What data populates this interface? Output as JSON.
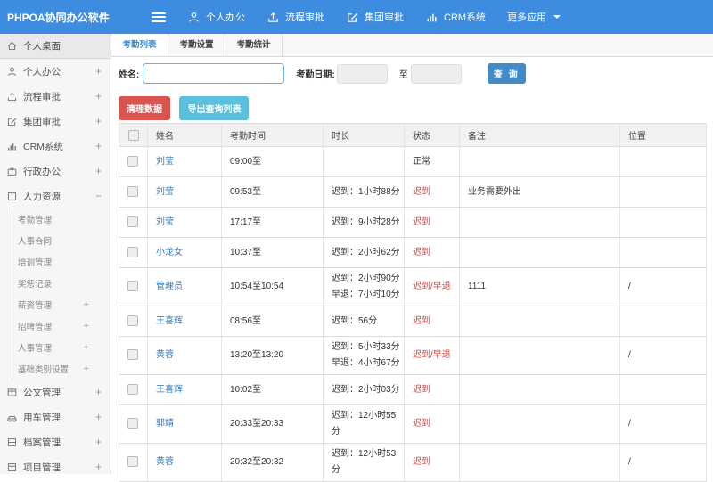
{
  "colors": {
    "header": "#3d8ce0",
    "primary": "#428bca",
    "danger": "#d9534f",
    "info": "#5bc0de",
    "link": "#3178b9",
    "alert_text": "#d9433c"
  },
  "brand": {
    "logo": "PHPOA协同办公软件"
  },
  "topnav": {
    "items": [
      {
        "icon": "user-icon",
        "label": "个人办公"
      },
      {
        "icon": "flow-icon",
        "label": "流程审批"
      },
      {
        "icon": "edit-icon",
        "label": "集团审批"
      },
      {
        "icon": "chart-icon",
        "label": "CRM系统"
      },
      {
        "icon": "",
        "label": "更多应用",
        "caret": true
      }
    ]
  },
  "sidebar": {
    "items": [
      {
        "label": "个人桌面",
        "icon": "home-icon",
        "level": "main",
        "active": true,
        "expand": ""
      },
      {
        "label": "个人办公",
        "icon": "user-icon",
        "level": "main",
        "expand": "+"
      },
      {
        "label": "流程审批",
        "icon": "flow-icon",
        "level": "main",
        "expand": "+"
      },
      {
        "label": "集团审批",
        "icon": "edit-icon",
        "level": "main",
        "expand": "+"
      },
      {
        "label": "CRM系统",
        "icon": "chart-icon",
        "level": "main",
        "expand": "+"
      },
      {
        "label": "行政办公",
        "icon": "briefcase-icon",
        "level": "main",
        "expand": "+"
      },
      {
        "label": "人力资源",
        "icon": "book-icon",
        "level": "main",
        "expand": "−"
      },
      {
        "label": "考勤管理",
        "level": "sub",
        "expand": ""
      },
      {
        "label": "人事合同",
        "level": "sub",
        "expand": ""
      },
      {
        "label": "培训管理",
        "level": "sub",
        "expand": ""
      },
      {
        "label": "奖惩记录",
        "level": "sub",
        "expand": ""
      },
      {
        "label": "薪资管理",
        "level": "sub",
        "expand": "+"
      },
      {
        "label": "招聘管理",
        "level": "sub",
        "expand": "+"
      },
      {
        "label": "人事管理",
        "level": "sub",
        "expand": "+"
      },
      {
        "label": "基础类别设置",
        "level": "sub",
        "expand": "+"
      },
      {
        "label": "公文管理",
        "icon": "document-icon",
        "level": "main",
        "expand": "+"
      },
      {
        "label": "用车管理",
        "icon": "car-icon",
        "level": "main",
        "expand": "+"
      },
      {
        "label": "档案管理",
        "icon": "archive-icon",
        "level": "main",
        "expand": "+"
      },
      {
        "label": "项目管理",
        "icon": "project-icon",
        "level": "main",
        "expand": "+"
      }
    ]
  },
  "tabs": [
    {
      "label": "考勤列表",
      "active": true
    },
    {
      "label": "考勤设置",
      "active": false
    },
    {
      "label": "考勤统计",
      "active": false
    }
  ],
  "filter": {
    "name_label": "姓名:",
    "name_value": "",
    "date_label": "考勤日期:",
    "date_from": "",
    "to_label": "至",
    "date_to": "",
    "search_label": "查 询"
  },
  "actions": {
    "clean_label": "清理数据",
    "export_label": "导出查询列表"
  },
  "attendance_table": {
    "headers": [
      "姓名",
      "考勤时间",
      "时长",
      "状态",
      "备注",
      "位置"
    ],
    "rows": [
      {
        "name": "刘莹",
        "time": "09:00至",
        "duration": "",
        "status": "正常",
        "status_type": "normal",
        "note": "",
        "location": ""
      },
      {
        "name": "刘莹",
        "time": "09:53至",
        "duration": "迟到：1小时88分",
        "status": "迟到",
        "status_type": "alert",
        "note": "业务需要外出",
        "location": ""
      },
      {
        "name": "刘莹",
        "time": "17:17至",
        "duration": "迟到：9小时28分",
        "status": "迟到",
        "status_type": "alert",
        "note": "",
        "location": ""
      },
      {
        "name": "小龙女",
        "time": "10:37至",
        "duration": "迟到：2小时62分",
        "status": "迟到",
        "status_type": "alert",
        "note": "",
        "location": ""
      },
      {
        "name": "管理员",
        "time": "10:54至10:54",
        "duration": "迟到：2小时90分\n早退：7小时10分",
        "status": "迟到/早退",
        "status_type": "alert",
        "note": "1111",
        "location": "/"
      },
      {
        "name": "王喜辉",
        "time": "08:56至",
        "duration": "迟到：56分",
        "status": "迟到",
        "status_type": "alert",
        "note": "",
        "location": ""
      },
      {
        "name": "黄蓉",
        "time": "13:20至13:20",
        "duration": "迟到：5小时33分\n早退：4小时67分",
        "status": "迟到/早退",
        "status_type": "alert",
        "note": "",
        "location": "/"
      },
      {
        "name": "王喜辉",
        "time": "10:02至",
        "duration": "迟到：2小时03分",
        "status": "迟到",
        "status_type": "alert",
        "note": "",
        "location": ""
      },
      {
        "name": "郭靖",
        "time": "20:33至20:33",
        "duration": "迟到：12小时55分",
        "status": "迟到",
        "status_type": "alert",
        "note": "",
        "location": "/"
      },
      {
        "name": "黄蓉",
        "time": "20:32至20:32",
        "duration": "迟到：12小时53分",
        "status": "迟到",
        "status_type": "alert",
        "note": "",
        "location": "/"
      }
    ]
  }
}
